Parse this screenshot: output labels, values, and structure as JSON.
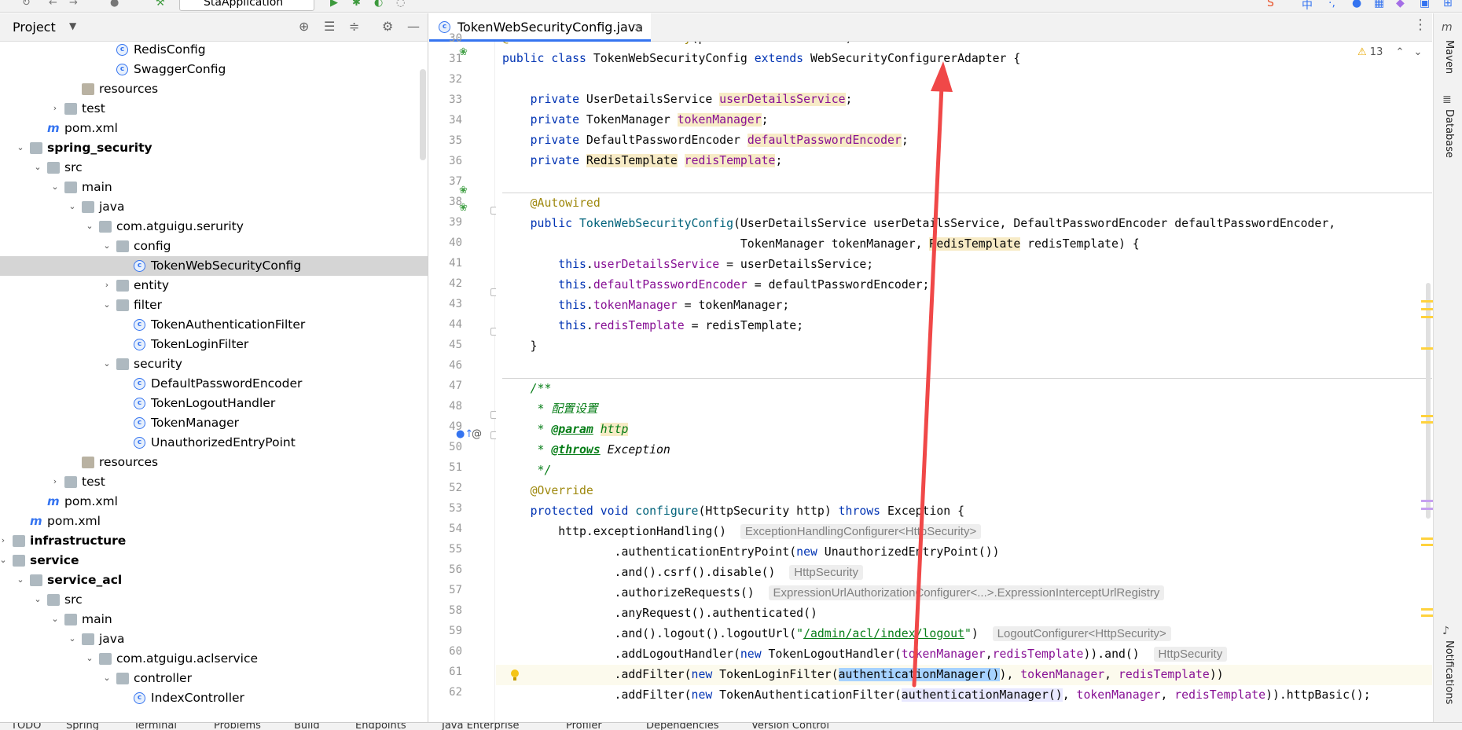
{
  "toolbar": {
    "run_config": "StaApplication",
    "ime": "中"
  },
  "project_panel": {
    "title": "Project"
  },
  "tree": [
    {
      "label": "RedisConfig",
      "type": "class",
      "indent": 7,
      "arrow": "",
      "bold": false,
      "selected": false
    },
    {
      "label": "SwaggerConfig",
      "type": "class",
      "indent": 7,
      "arrow": "",
      "bold": false,
      "selected": false
    },
    {
      "label": "resources",
      "type": "resfolder",
      "indent": 5,
      "arrow": "",
      "bold": false,
      "selected": false
    },
    {
      "label": "test",
      "type": "folder",
      "indent": 4,
      "arrow": "right",
      "bold": false,
      "selected": false
    },
    {
      "label": "pom.xml",
      "type": "maven",
      "indent": 3,
      "arrow": "",
      "bold": false,
      "selected": false
    },
    {
      "label": "spring_security",
      "type": "folder",
      "indent": 2,
      "arrow": "down",
      "bold": true,
      "selected": false
    },
    {
      "label": "src",
      "type": "folder",
      "indent": 3,
      "arrow": "down",
      "bold": false,
      "selected": false
    },
    {
      "label": "main",
      "type": "folder",
      "indent": 4,
      "arrow": "down",
      "bold": false,
      "selected": false
    },
    {
      "label": "java",
      "type": "folder",
      "indent": 5,
      "arrow": "down",
      "bold": false,
      "selected": false
    },
    {
      "label": "com.atguigu.serurity",
      "type": "package",
      "indent": 6,
      "arrow": "down",
      "bold": false,
      "selected": false
    },
    {
      "label": "config",
      "type": "package",
      "indent": 7,
      "arrow": "down",
      "bold": false,
      "selected": false
    },
    {
      "label": "TokenWebSecurityConfig",
      "type": "class",
      "indent": 8,
      "arrow": "",
      "bold": false,
      "selected": true
    },
    {
      "label": "entity",
      "type": "package",
      "indent": 7,
      "arrow": "right",
      "bold": false,
      "selected": false
    },
    {
      "label": "filter",
      "type": "package",
      "indent": 7,
      "arrow": "down",
      "bold": false,
      "selected": false
    },
    {
      "label": "TokenAuthenticationFilter",
      "type": "class",
      "indent": 8,
      "arrow": "",
      "bold": false,
      "selected": false
    },
    {
      "label": "TokenLoginFilter",
      "type": "class",
      "indent": 8,
      "arrow": "",
      "bold": false,
      "selected": false
    },
    {
      "label": "security",
      "type": "package",
      "indent": 7,
      "arrow": "down",
      "bold": false,
      "selected": false
    },
    {
      "label": "DefaultPasswordEncoder",
      "type": "class",
      "indent": 8,
      "arrow": "",
      "bold": false,
      "selected": false
    },
    {
      "label": "TokenLogoutHandler",
      "type": "class",
      "indent": 8,
      "arrow": "",
      "bold": false,
      "selected": false
    },
    {
      "label": "TokenManager",
      "type": "class",
      "indent": 8,
      "arrow": "",
      "bold": false,
      "selected": false
    },
    {
      "label": "UnauthorizedEntryPoint",
      "type": "class",
      "indent": 8,
      "arrow": "",
      "bold": false,
      "selected": false
    },
    {
      "label": "resources",
      "type": "resfolder",
      "indent": 5,
      "arrow": "",
      "bold": false,
      "selected": false
    },
    {
      "label": "test",
      "type": "folder",
      "indent": 4,
      "arrow": "right",
      "bold": false,
      "selected": false
    },
    {
      "label": "pom.xml",
      "type": "maven",
      "indent": 3,
      "arrow": "",
      "bold": false,
      "selected": false
    },
    {
      "label": "pom.xml",
      "type": "maven",
      "indent": 2,
      "arrow": "",
      "bold": false,
      "selected": false
    },
    {
      "label": "infrastructure",
      "type": "folder",
      "indent": 1,
      "arrow": "right",
      "bold": true,
      "selected": false
    },
    {
      "label": "service",
      "type": "folder",
      "indent": 1,
      "arrow": "down",
      "bold": true,
      "selected": false
    },
    {
      "label": "service_acl",
      "type": "folder",
      "indent": 2,
      "arrow": "down",
      "bold": true,
      "selected": false
    },
    {
      "label": "src",
      "type": "folder",
      "indent": 3,
      "arrow": "down",
      "bold": false,
      "selected": false
    },
    {
      "label": "main",
      "type": "folder",
      "indent": 4,
      "arrow": "down",
      "bold": false,
      "selected": false
    },
    {
      "label": "java",
      "type": "folder",
      "indent": 5,
      "arrow": "down",
      "bold": false,
      "selected": false
    },
    {
      "label": "com.atguigu.aclservice",
      "type": "package",
      "indent": 6,
      "arrow": "down",
      "bold": false,
      "selected": false
    },
    {
      "label": "controller",
      "type": "package",
      "indent": 7,
      "arrow": "down",
      "bold": false,
      "selected": false
    },
    {
      "label": "IndexController",
      "type": "class",
      "indent": 8,
      "arrow": "",
      "bold": false,
      "selected": false
    }
  ],
  "editor": {
    "tab_label": "TokenWebSecurityConfig.java",
    "tab_close": "×",
    "inspections_count": "13",
    "line_numbers": [
      "30",
      "31",
      "32",
      "33",
      "34",
      "35",
      "36",
      "37",
      "38",
      "39",
      "40",
      "41",
      "42",
      "43",
      "44",
      "45",
      "46",
      "47",
      "48",
      "49",
      "50",
      "51",
      "52",
      "53",
      "54",
      "55",
      "56",
      "57",
      "58",
      "59",
      "60",
      "61",
      "62"
    ],
    "hints": {
      "l54": "ExceptionHandlingConfigurer<HttpSecurity>",
      "l56": "HttpSecurity",
      "l57": "ExpressionUrlAuthorizationConfigurer<...>.ExpressionInterceptUrlRegistry",
      "l59": "LogoutConfigurer<HttpSecurity>",
      "l60": "HttpSecurity"
    },
    "comment_cn": " * 配置设置"
  },
  "right_tools": {
    "maven": "Maven",
    "database": "Database",
    "notifications": "Notifications"
  },
  "bottom_tools": [
    "TODO",
    "Spring",
    "Terminal",
    "Problems",
    "Build",
    "Endpoints",
    "Java Enterprise",
    "Profiler",
    "Dependencies",
    "Version Control"
  ],
  "colors": {
    "keyword": "#0033b3",
    "field": "#871094",
    "annotation": "#9e880d",
    "accent": "#3574f0",
    "overlay_arrow": "#f04848"
  }
}
